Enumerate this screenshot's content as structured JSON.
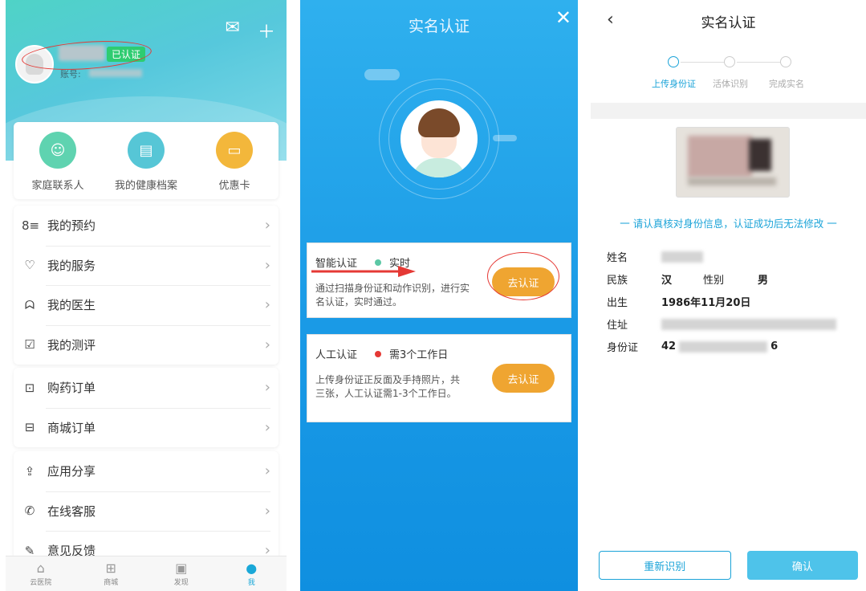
{
  "panel1": {
    "verified_badge": "已认证",
    "account_label": "账号:",
    "quick": [
      {
        "label": "家庭联系人",
        "color": "#5fd3b0",
        "icon": "contacts-icon"
      },
      {
        "label": "我的健康档案",
        "color": "#56c6d6",
        "icon": "health-record-icon"
      },
      {
        "label": "优惠卡",
        "color": "#f3b73b",
        "icon": "wallet-icon"
      }
    ],
    "group1": [
      {
        "label": "我的预约",
        "icon": "appointment-icon"
      },
      {
        "label": "我的服务",
        "icon": "service-icon"
      },
      {
        "label": "我的医生",
        "icon": "doctor-icon"
      },
      {
        "label": "我的测评",
        "icon": "assessment-icon"
      }
    ],
    "group2": [
      {
        "label": "购药订单",
        "icon": "cart-icon"
      },
      {
        "label": "商城订单",
        "icon": "shop-icon"
      }
    ],
    "group3": [
      {
        "label": "应用分享",
        "icon": "share-icon"
      },
      {
        "label": "在线客服",
        "icon": "phone-icon"
      },
      {
        "label": "意见反馈",
        "icon": "feedback-icon"
      }
    ],
    "tabs": [
      {
        "label": "云医院",
        "icon": "home-icon"
      },
      {
        "label": "商城",
        "icon": "mall-icon"
      },
      {
        "label": "发现",
        "icon": "discover-icon"
      },
      {
        "label": "我",
        "icon": "profile-icon",
        "active": true
      }
    ]
  },
  "panel2": {
    "title": "实名认证",
    "smart": {
      "name": "智能认证",
      "tag": "实时",
      "desc": "通过扫描身份证和动作识别，进行实名认证，实时通过。",
      "button": "去认证"
    },
    "manual": {
      "name": "人工认证",
      "tag": "需3个工作日",
      "desc": "上传身份证正反面及手持照片，共三张，人工认证需1-3个工作日。",
      "button": "去认证"
    }
  },
  "panel3": {
    "title": "实名认证",
    "steps": [
      "上传身份证",
      "活体识别",
      "完成实名"
    ],
    "notice": "一 请认真核对身份信息，认证成功后无法修改 一",
    "name_label": "姓名",
    "ethnicity_label": "民族",
    "ethnicity": "汉",
    "gender_label": "性别",
    "gender": "男",
    "birth_label": "出生",
    "birth": "1986年11月20日",
    "address_label": "住址",
    "id_label": "身份证",
    "id_prefix": "42",
    "id_suffix": "6",
    "rescan_button": "重新识别",
    "confirm_button": "确认"
  }
}
